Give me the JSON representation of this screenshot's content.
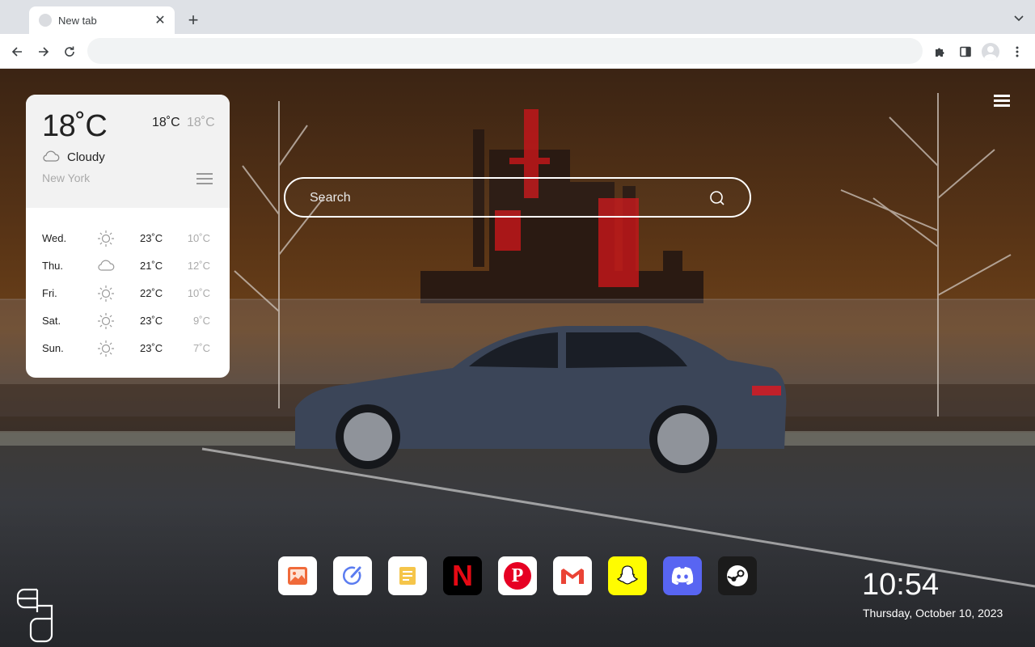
{
  "browser": {
    "tab_title": "New tab",
    "tab_close": "✕",
    "new_tab": "+",
    "address_value": "",
    "address_placeholder": ""
  },
  "weather": {
    "current_temp": "18˚C",
    "high": "18˚C",
    "low": "18˚C",
    "condition": "Cloudy",
    "condition_icon": "cloud-icon",
    "city": "New York",
    "forecast": [
      {
        "day": "Wed.",
        "icon": "sun-icon",
        "high": "23˚C",
        "low": "10˚C"
      },
      {
        "day": "Thu.",
        "icon": "cloud-icon",
        "high": "21˚C",
        "low": "12˚C"
      },
      {
        "day": "Fri.",
        "icon": "sun-icon",
        "high": "22˚C",
        "low": "10˚C"
      },
      {
        "day": "Sat.",
        "icon": "sun-icon",
        "high": "23˚C",
        "low": "9˚C"
      },
      {
        "day": "Sun.",
        "icon": "sun-icon",
        "high": "23˚C",
        "low": "7˚C"
      }
    ]
  },
  "search": {
    "placeholder": "Search"
  },
  "dock": {
    "apps": [
      "photos-app-icon",
      "edit-app-icon",
      "notes-app-icon",
      "netflix-app-icon",
      "pinterest-app-icon",
      "gmail-app-icon",
      "snapchat-app-icon",
      "discord-app-icon",
      "steam-app-icon"
    ],
    "netflix_letter": "N",
    "pinterest_letter": "P"
  },
  "clock": {
    "time": "10:54",
    "date": "Thursday, October 10, 2023"
  },
  "colors": {
    "netflix": "#000000",
    "netflix_red": "#e50914",
    "pinterest": "#e60023",
    "snapchat": "#fffc00",
    "discord": "#5865f2",
    "steam": "#1b1b1b"
  }
}
